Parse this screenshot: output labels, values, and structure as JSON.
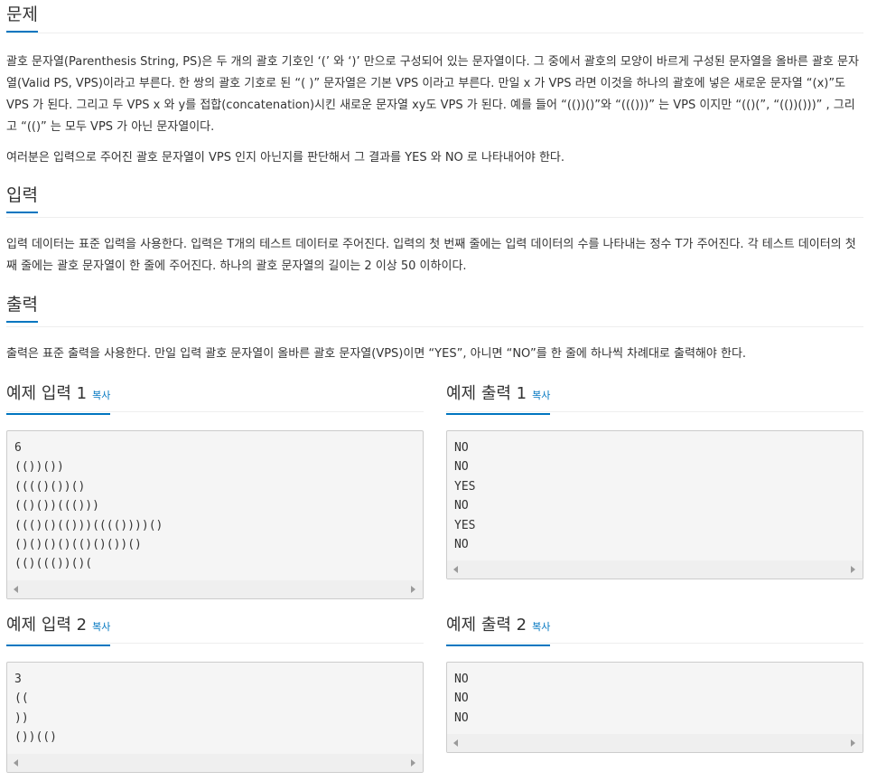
{
  "problem": {
    "title": "문제",
    "paragraphs": [
      "괄호 문자열(Parenthesis String, PS)은 두 개의 괄호 기호인 ‘(’ 와 ‘)’ 만으로 구성되어 있는 문자열이다. 그 중에서 괄호의 모양이 바르게 구성된 문자열을 올바른 괄호 문자열(Valid PS, VPS)이라고 부른다. 한 쌍의 괄호 기호로 된 “( )” 문자열은 기본 VPS 이라고 부른다. 만일 x 가 VPS 라면 이것을 하나의 괄호에 넣은 새로운 문자열 “(x)”도 VPS 가 된다. 그리고 두 VPS x 와 y를 접합(concatenation)시킨 새로운 문자열 xy도 VPS 가 된다. 예를 들어 “(())()”와 “((()))” 는 VPS 이지만 “(()(”, “(())()))” , 그리고 “(()” 는 모두 VPS 가 아닌 문자열이다.",
      "여러분은 입력으로 주어진 괄호 문자열이 VPS 인지 아닌지를 판단해서 그 결과를 YES 와 NO 로 나타내어야 한다."
    ]
  },
  "input": {
    "title": "입력",
    "paragraph": "입력 데이터는 표준 입력을 사용한다. 입력은 T개의 테스트 데이터로 주어진다. 입력의 첫 번째 줄에는 입력 데이터의 수를 나타내는 정수 T가 주어진다. 각 테스트 데이터의 첫째 줄에는 괄호 문자열이 한 줄에 주어진다. 하나의 괄호 문자열의 길이는 2 이상 50 이하이다."
  },
  "output": {
    "title": "출력",
    "paragraph": "출력은 표준 출력을 사용한다. 만일 입력 괄호 문자열이 올바른 괄호 문자열(VPS)이면 “YES”, 아니면 “NO”를 한 줄에 하나씩 차례대로 출력해야 한다."
  },
  "copy_label": "복사",
  "samples": [
    {
      "title": "예제 입력 1",
      "lines": [
        "6",
        "(())())",
        "(((()())()",
        "(()())((()))",
        "((()()(()))(((())))()",
        "()()()()(()()())()",
        "(()((())()("
      ]
    },
    {
      "title": "예제 출력 1",
      "lines": [
        "NO",
        "NO",
        "YES",
        "NO",
        "YES",
        "NO"
      ]
    },
    {
      "title": "예제 입력 2",
      "lines": [
        "3",
        "((",
        "))",
        "())(()"
      ]
    },
    {
      "title": "예제 출력 2",
      "lines": [
        "NO",
        "NO",
        "NO"
      ]
    }
  ],
  "colors": {
    "accent": "#0076c0",
    "text": "#333333",
    "code_bg": "#f5f5f5"
  }
}
